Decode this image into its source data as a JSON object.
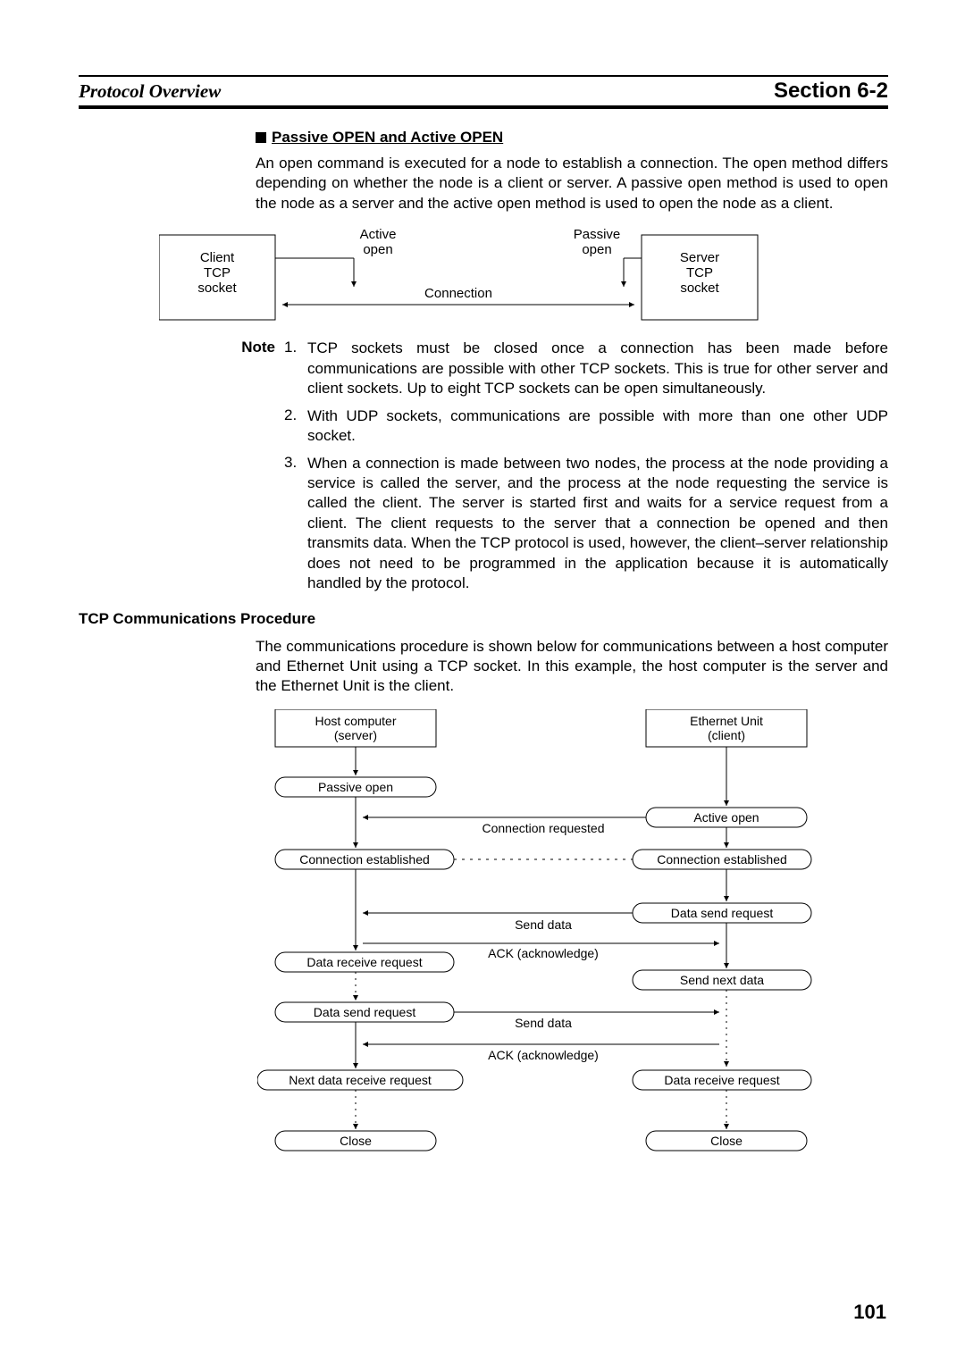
{
  "header": {
    "left": "Protocol Overview",
    "right": "Section 6-2"
  },
  "subheading": "Passive OPEN and Active OPEN",
  "intro": "An open command is executed for a node to establish a connection. The open method differs depending on whether the node is a client or server. A passive open method is used to open the node as a server and the active open method is used to open the node as a client.",
  "diagram1": {
    "client_l1": "Client",
    "client_l2": "TCP",
    "client_l3": "socket",
    "server_l1": "Server",
    "server_l2": "TCP",
    "server_l3": "socket",
    "active_l1": "Active",
    "active_l2": "open",
    "passive_l1": "Passive",
    "passive_l2": "open",
    "connection": "Connection"
  },
  "note_label": "Note",
  "notes": {
    "n1_num": "1.",
    "n1": "TCP sockets must be closed once a connection has been made before communications are possible with other TCP sockets. This is true for other server and client sockets. Up to eight TCP sockets can be open simultaneously.",
    "n2_num": "2.",
    "n2": "With UDP sockets, communications are possible with more than one other UDP socket.",
    "n3_num": "3.",
    "n3": "When a connection is made between two nodes, the process at the node providing a service is called the server, and the process at the node requesting the service is called the client. The server is started first and waits for a service request from a client. The client requests to the server that a connection be opened and then transmits data. When the TCP protocol is used, however, the client–server relationship does not need to be programmed in the application because it is automatically handled by the protocol."
  },
  "tcp_heading": "TCP Communications Procedure",
  "tcp_intro": "The communications procedure is shown below for communications between a host computer and Ethernet Unit using a TCP socket. In this example, the host computer is the server and the Ethernet Unit is the client.",
  "flow": {
    "host_l1": "Host computer",
    "host_l2": "(server)",
    "eth_l1": "Ethernet Unit",
    "eth_l2": "(client)",
    "passive_open": "Passive open",
    "active_open": "Active open",
    "conn_req": "Connection requested",
    "conn_est": "Connection established",
    "send_data": "Send data",
    "data_send_req": "Data send request",
    "ack": "ACK (acknowledge)",
    "data_recv_req": "Data receive request",
    "send_next": "Send next data",
    "next_recv_req": "Next data receive request",
    "close": "Close"
  },
  "page_number": "101"
}
